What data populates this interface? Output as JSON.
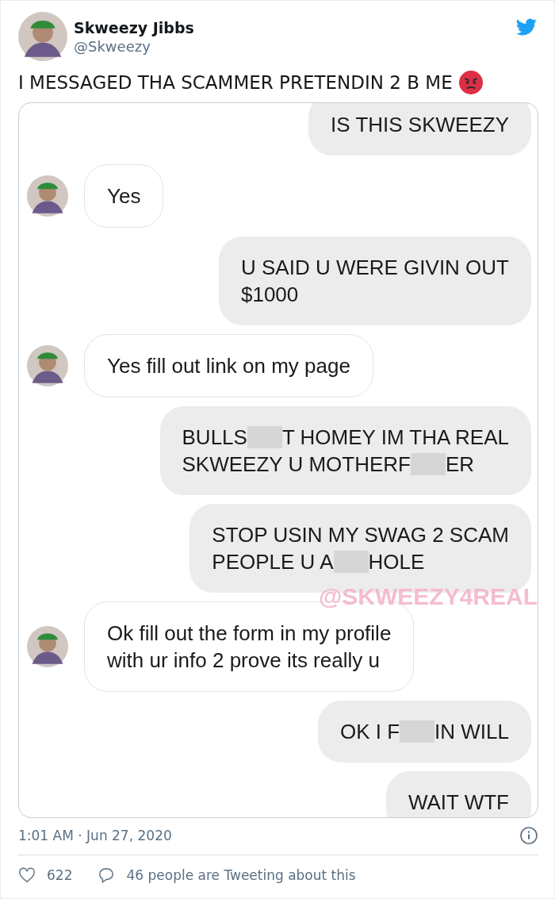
{
  "author": {
    "name": "Skweezy Jibbs",
    "handle": "@Skweezy"
  },
  "tweet_text": "I MESSAGED THA SCAMMER PRETENDIN 2 B ME",
  "chat": {
    "overlay_text": "@SKWEEZY4REAL",
    "messages": [
      {
        "kind": "sent",
        "lines": [
          [
            "IS THIS SKWEEZY"
          ]
        ]
      },
      {
        "kind": "received",
        "lines": [
          [
            "Yes"
          ]
        ]
      },
      {
        "kind": "sent",
        "lines": [
          [
            "U SAID U WERE GIVIN OUT"
          ],
          [
            "$1000"
          ]
        ]
      },
      {
        "kind": "received",
        "lines": [
          [
            "Yes fill out link on my page"
          ]
        ]
      },
      {
        "kind": "sent",
        "lines": [
          [
            "BULLS",
            "T HOMEY IM THA REAL"
          ],
          [
            "SKWEEZY U MOTHERF",
            "ER"
          ]
        ]
      },
      {
        "kind": "sent",
        "lines": [
          [
            "STOP USIN MY SWAG 2 SCAM"
          ],
          [
            "PEOPLE U A",
            "HOLE"
          ]
        ]
      },
      {
        "kind": "received",
        "lines": [
          [
            "Ok fill out the form in my profile"
          ],
          [
            "with ur info 2 prove its really u"
          ]
        ]
      },
      {
        "kind": "sent",
        "lines": [
          [
            "OK I F",
            "IN WILL"
          ]
        ]
      },
      {
        "kind": "sent",
        "lines": [
          [
            "WAIT WTF"
          ]
        ]
      }
    ]
  },
  "timestamp": "1:01 AM · Jun 27, 2020",
  "likes": "622",
  "replies_text": "46 people are Tweeting about this"
}
